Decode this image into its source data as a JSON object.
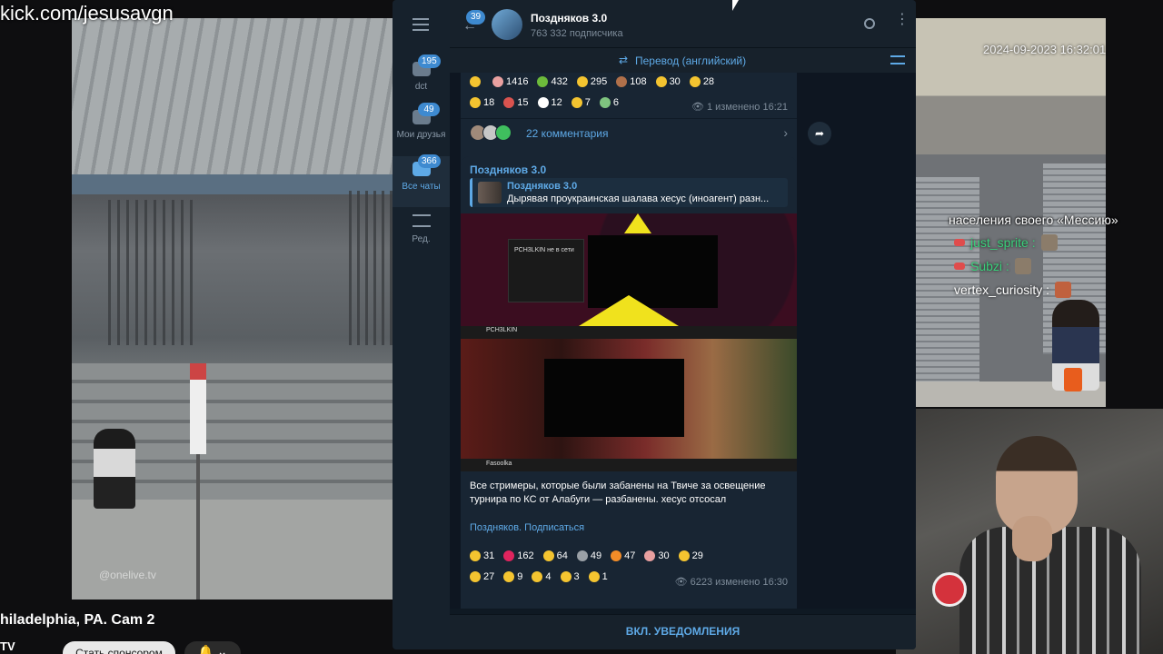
{
  "stream": {
    "url": "kick.com/jesusavgn",
    "camera_title": "hiladelphia, PA. Cam 2",
    "camera_sub": "TV",
    "sponsor_button": "Стать спонсором",
    "bell_button": "🔔 ⌄",
    "watermark": "@onelive.tv",
    "cam_timestamp": "2024-09-2023 16:32:01"
  },
  "chat_overlay": {
    "message": "населения своего «Мессию»",
    "users": [
      {
        "name": "just_sprite :",
        "color": "#39d07a"
      },
      {
        "name": "Subzi :",
        "color": "#39d07a"
      },
      {
        "name": "vertex_curiosity :",
        "color": "#ffffff"
      }
    ]
  },
  "telegram": {
    "rail": [
      {
        "label": "dct",
        "count": "195"
      },
      {
        "label": "Мои друзья",
        "count": "49"
      },
      {
        "label": "Все чаты",
        "count": "366"
      },
      {
        "label": "Ред.",
        "count": ""
      }
    ],
    "header": {
      "back_count": "39",
      "channel_name": "Поздняков 3.0",
      "subscribers": "763 332 подписчика"
    },
    "translate_label": "Перевод (английский)",
    "post1": {
      "reactions_row1": [
        {
          "emoji_color": "#f4c430",
          "count": ""
        },
        {
          "emoji_color": "#e9a0a0",
          "count": "1416"
        },
        {
          "emoji_color": "#6dbb3b",
          "count": "432"
        },
        {
          "emoji_color": "#f4c430",
          "count": "295"
        },
        {
          "emoji_color": "#b0704a",
          "count": "108"
        },
        {
          "emoji_color": "#f4c430",
          "count": "30"
        },
        {
          "emoji_color": "#f4c430",
          "count": "28"
        }
      ],
      "reactions_row2": [
        {
          "emoji_color": "#f4c430",
          "count": "18"
        },
        {
          "emoji_color": "#d9534f",
          "count": "15"
        },
        {
          "emoji_color": "#ffffff",
          "count": "12"
        },
        {
          "emoji_color": "#f4c430",
          "count": "7"
        },
        {
          "emoji_color": "#7fc47f",
          "count": "6"
        }
      ],
      "views": "👁 1",
      "edited": "изменено 16:21",
      "comments": "22 комментария"
    },
    "post2": {
      "author": "Поздняков 3.0",
      "forward_name": "Поздняков 3.0",
      "forward_text": "Дырявая проукраинская шалава хесус (иноагент) разн...",
      "media1_card": "PCH3LKIN не в сети",
      "media2_top": "PCH3LKIN",
      "media2_bottom": "Fasoolka",
      "text": "Все стримеры, которые были забанены на Твиче за освещение турнира по КС от Алабуги — разбанены. хесус отсосал",
      "link": "Поздняков. Подписаться",
      "reactions_row1": [
        {
          "emoji_color": "#f4c430",
          "count": "31"
        },
        {
          "emoji_color": "#e0245e",
          "count": "162"
        },
        {
          "emoji_color": "#f4c430",
          "count": "64"
        },
        {
          "emoji_color": "#9aa0a6",
          "count": "49"
        },
        {
          "emoji_color": "#f28c28",
          "count": "47"
        },
        {
          "emoji_color": "#e9a0a0",
          "count": "30"
        },
        {
          "emoji_color": "#f4c430",
          "count": "29"
        }
      ],
      "reactions_row2": [
        {
          "emoji_color": "#f4c430",
          "count": "27"
        },
        {
          "emoji_color": "#f4c430",
          "count": "9"
        },
        {
          "emoji_color": "#f4c430",
          "count": "4"
        },
        {
          "emoji_color": "#f4c430",
          "count": "3"
        },
        {
          "emoji_color": "#f4c430",
          "count": "1"
        }
      ],
      "views": "👁 6223",
      "edited": "изменено 16:30"
    },
    "footer_button": "ВКЛ. УВЕДОМЛЕНИЯ"
  },
  "colors": {
    "accent": "#5ea9e6",
    "bubble": "#182533",
    "background": "#0e1621"
  }
}
